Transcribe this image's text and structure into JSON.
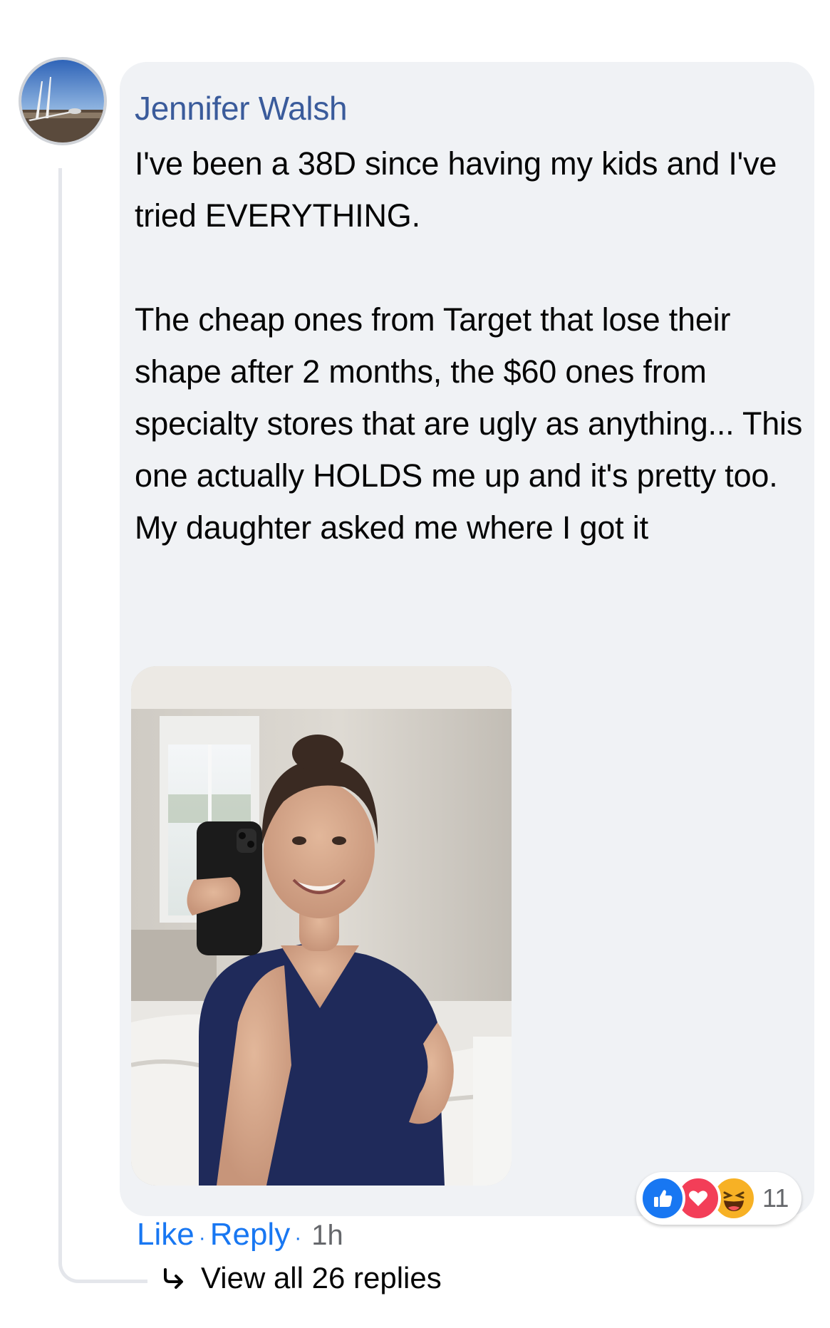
{
  "comment": {
    "author": "Jennifer Walsh",
    "paragraphs": [
      "I've been a 38D since having my kids and I've tried EVERYTHING.",
      "The cheap ones from Target that lose their shape after 2 months, the $60 ones from specialty stores that are ugly as anything... This one actually HOLDS me up and it's pretty too. My daughter asked me where I got it"
    ],
    "reactions": {
      "icons": [
        "like-icon",
        "love-icon",
        "haha-icon"
      ],
      "count": "11"
    },
    "actions": {
      "like_label": "Like",
      "separator": "·",
      "reply_label": "Reply",
      "time": "1h"
    },
    "view_replies_label": "View all 26 replies"
  },
  "colors": {
    "author_name": "#3a5b9b",
    "link_blue": "#1877f2",
    "bubble_bg": "#f0f2f5",
    "like_blue": "#1877f2",
    "love_red": "#f33e58",
    "haha_yellow": "#f7b125"
  }
}
